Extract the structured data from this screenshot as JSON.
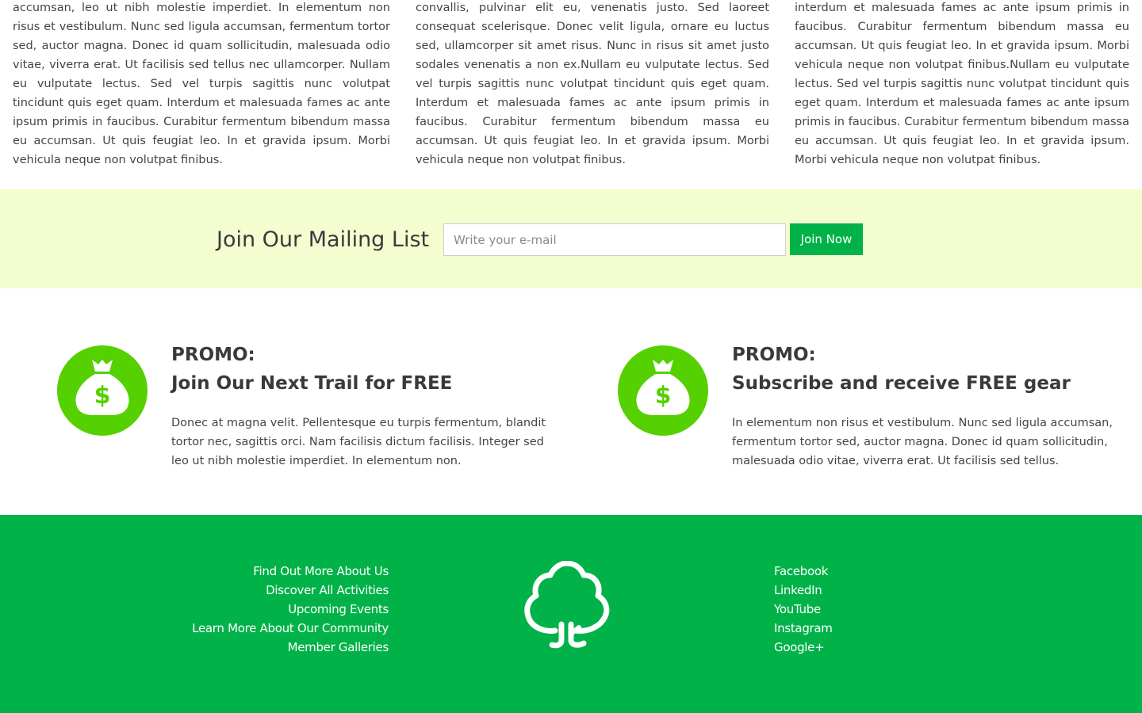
{
  "articles": [
    "In elementum non risus et vestibulum. Nunc sed ligula accumsan, leo ut nibh molestie imperdiet. In elementum non risus et vestibulum. Nunc sed ligula accumsan, fermentum tortor sed, auctor magna. Donec id quam sollicitudin, malesuada odio vitae, viverra erat. Ut facilisis sed tellus nec ullamcorper. Nullam eu vulputate lectus. Sed vel turpis sagittis nunc volutpat tincidunt quis eget quam. Interdum et malesuada fames ac ante ipsum primis in faucibus. Curabitur fermentum bibendum massa eu accumsan. Ut quis feugiat leo. In et gravida ipsum. Morbi vehicula neque non volutpat finibus.",
    "Donec at magna velit. Pellentesque eu turpis augue convallis, pulvinar elit eu, venenatis justo. Sed laoreet consequat scelerisque. Donec velit ligula, ornare eu luctus sed, ullamcorper sit amet risus. Nunc in risus sit amet justo sodales venenatis a non ex.Nullam eu vulputate lectus. Sed vel turpis sagittis nunc volutpat tincidunt quis eget quam. Interdum et malesuada fames ac ante ipsum primis in faucibus. Curabitur fermentum bibendum massa eu accumsan. Ut quis feugiat leo. In et gravida ipsum. Morbi vehicula neque non volutpat finibus.",
    "Nunc sed ligula accumsan, fermentum tortor sed, interdum et malesuada fames ac ante ipsum primis in faucibus. Curabitur fermentum bibendum massa eu accumsan. Ut quis feugiat leo. In et gravida ipsum. Morbi vehicula neque non volutpat finibus.Nullam eu vulputate lectus. Sed vel turpis sagittis nunc volutpat tincidunt quis eget quam. Interdum et malesuada fames ac ante ipsum primis in faucibus. Curabitur fermentum bibendum massa eu accumsan. Ut quis feugiat leo. In et gravida ipsum. Morbi vehicula neque non volutpat finibus."
  ],
  "mailing": {
    "title": "Join Our Mailing List",
    "placeholder": "Write your e-mail",
    "button": "Join Now"
  },
  "promos": [
    {
      "label": "PROMO:",
      "title": "Join Our Next Trail for FREE",
      "text": "Donec at magna velit. Pellentesque eu turpis fermentum, blandit tortor nec, sagittis orci. Nam facilisis dictum facilisis. Integer sed leo ut nibh molestie imperdiet. In elementum non.",
      "icon": "money-bag-icon"
    },
    {
      "label": "PROMO:",
      "title": "Subscribe and receive FREE gear",
      "text": "In elementum non risus et vestibulum. Nunc sed ligula accumsan, fermentum tortor sed, auctor magna. Donec id quam sollicitudin, malesuada odio vitae, viverra erat. Ut facilisis sed tellus.",
      "icon": "money-bag-icon"
    }
  ],
  "footer": {
    "left_links": [
      "Find Out More About Us",
      "Discover All Activities",
      "Upcoming Events",
      "Learn More About Our Community",
      "Member Galleries"
    ],
    "right_links": [
      "Facebook",
      "LinkedIn",
      "YouTube",
      "Instagram",
      "Google+"
    ],
    "logo_icon": "tree-icon"
  },
  "colors": {
    "brand_green": "#00b248",
    "icon_green": "#55d000",
    "mailing_bg": "#f4fdd0",
    "text": "#444444"
  }
}
